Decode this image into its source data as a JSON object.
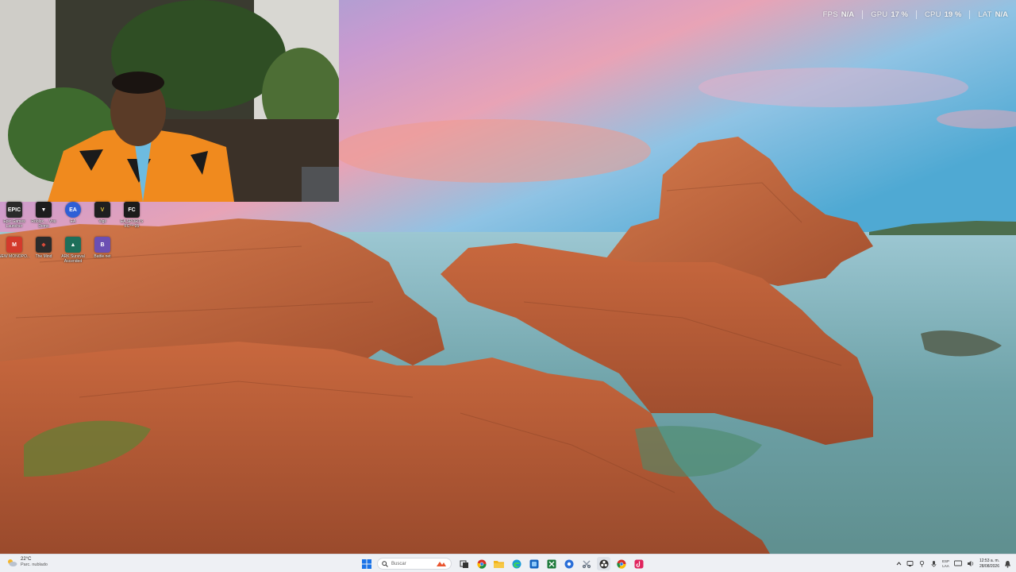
{
  "overlay": {
    "stats": [
      {
        "label": "FPS",
        "value": "N/A"
      },
      {
        "label": "GPU",
        "value": "17 %"
      },
      {
        "label": "CPU",
        "value": "19 %"
      },
      {
        "label": "LAT",
        "value": "N/A"
      }
    ]
  },
  "desktop_icons": [
    {
      "label": "Epic Games Launcher",
      "icon": "epic-games-icon",
      "color": "#2a2a2a",
      "glyph": "EPIC"
    },
    {
      "label": "Roblox ... Vou Demo",
      "icon": "game-icon",
      "color": "#1d1d1d",
      "glyph": "▼"
    },
    {
      "label": "EA",
      "icon": "ea-icon",
      "color": "#2f5fd6",
      "glyph": "EA"
    },
    {
      "label": "Vigil",
      "icon": "vigil-icon",
      "color": "#1f1f1f",
      "glyph": "V"
    },
    {
      "label": "EA SPORTS FC™ 25",
      "icon": "ea-sports-fc-icon",
      "color": "#1b1b1b",
      "glyph": "FC"
    },
    {
      "label": "NEW MONOPO...",
      "icon": "monopoly-icon",
      "color": "#d33a2c",
      "glyph": "M"
    },
    {
      "label": "The Mind",
      "icon": "the-mind-icon",
      "color": "#2b2b2b",
      "glyph": "◆"
    },
    {
      "label": "ARK Survival Ascended",
      "icon": "ark-icon",
      "color": "#1d6f5a",
      "glyph": "▲"
    },
    {
      "label": "Battle.net",
      "icon": "battlenet-icon",
      "color": "#6b4fb3",
      "glyph": "B"
    }
  ],
  "taskbar": {
    "weather": {
      "temp": "22°C",
      "condition": "Parc. nublado",
      "icon": "partly-cloudy-icon"
    },
    "search_placeholder": "Buscar",
    "apps": [
      {
        "name": "file-explorer-icon",
        "color": "#f2b51c"
      },
      {
        "name": "chrome-icon",
        "color": "#2f9e44"
      },
      {
        "name": "edge-icon",
        "color": "#1a9bd8"
      },
      {
        "name": "photos-icon",
        "color": "#1565c0"
      },
      {
        "name": "excel-icon",
        "color": "#1d7a3a"
      },
      {
        "name": "edge-beta-icon",
        "color": "#2b6fd8"
      },
      {
        "name": "app-icon",
        "color": "#8f9aa8"
      },
      {
        "name": "obs-icon",
        "color": "#333333"
      },
      {
        "name": "chrome-alt-icon",
        "color": "#d93025"
      },
      {
        "name": "tiktok-icon",
        "color": "#e0245e"
      }
    ],
    "tray": {
      "language_top": "ESP",
      "language_bottom": "LAA",
      "time": "12:53 a. m.",
      "date": "28/08/2026"
    }
  }
}
